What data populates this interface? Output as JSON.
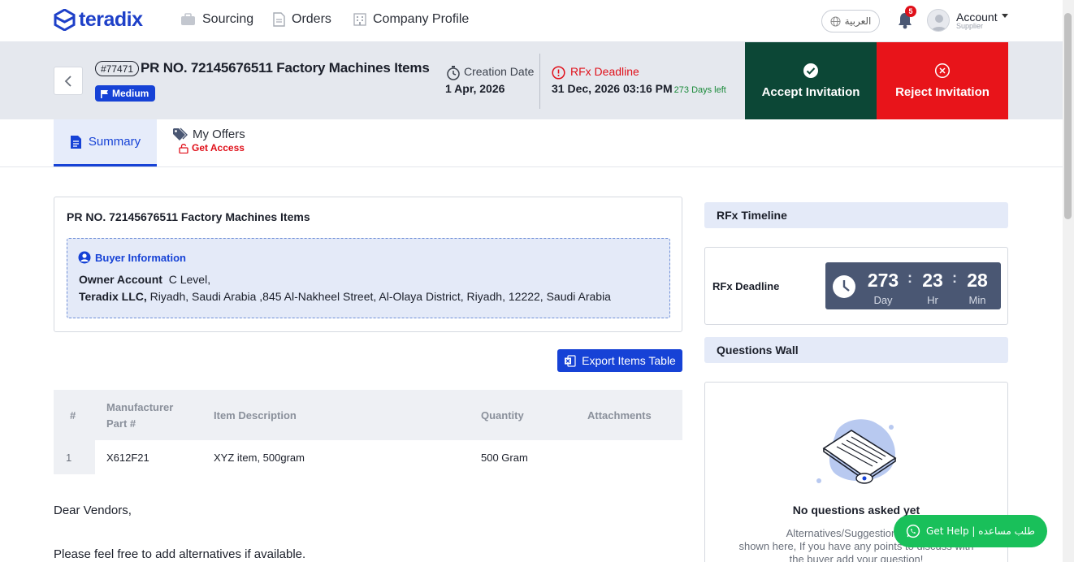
{
  "brand": {
    "name": "teradix"
  },
  "nav": {
    "sourcing": "Sourcing",
    "orders": "Orders",
    "company_profile": "Company Profile",
    "language": "العربية",
    "notifications_count": "5",
    "account_name": "Account",
    "account_role": "Supplier"
  },
  "header": {
    "pr_number_tag": "#77471",
    "title": "PR NO. 72145676511 Factory Machines Items",
    "priority": "Medium",
    "creation_date_label": "Creation Date",
    "creation_date": "1 Apr, 2026",
    "deadline_label": "RFx Deadline",
    "deadline": "31 Dec, 2026 03:16 PM",
    "days_left": "273 Days left",
    "accept_label": "Accept Invitation",
    "reject_label": "Reject Invitation"
  },
  "tabs": {
    "summary": "Summary",
    "my_offers": "My Offers",
    "get_access": "Get Access"
  },
  "summary": {
    "title": "PR NO. 72145676511 Factory Machines Items",
    "buyer_heading": "Buyer Information",
    "owner_label": "Owner Account",
    "owner_value": "C Level,",
    "company_name": "Teradix LLC,",
    "company_address": "Riyadh, Saudi Arabia ,845 Al-Nakheel Street, Al-Olaya District, Riyadh, 12222, Saudi Arabia",
    "export_label": "Export Items Table"
  },
  "items_table": {
    "headers": {
      "index": "#",
      "part_line1": "Manufacturer",
      "part_line2": "Part #",
      "description": "Item Description",
      "quantity": "Quantity",
      "attachments": "Attachments"
    },
    "rows": [
      {
        "index": "1",
        "part": "X612F21",
        "description": "XYZ item, 500gram",
        "quantity": "500 Gram",
        "attachments": ""
      }
    ]
  },
  "notes": {
    "greeting": "Dear Vendors,",
    "line1": "Please feel free to add alternatives if available."
  },
  "timeline": {
    "heading": "RFx Timeline",
    "deadline_label": "RFx Deadline",
    "days": "273",
    "days_unit": "Day",
    "hours": "23",
    "hours_unit": "Hr",
    "minutes": "28",
    "minutes_unit": "Min"
  },
  "questions": {
    "heading": "Questions Wall",
    "empty_title": "No questions asked yet",
    "empty_desc_line1": "Alternatives/Suggestions from",
    "empty_desc_line2": "shown here, If you have any points to discuss with",
    "empty_desc_line3": "the buyer add your question!"
  },
  "help": {
    "label": "Get Help | طلب مساعده"
  },
  "colors": {
    "primary": "#1642d6",
    "accept": "#0c4736",
    "reject": "#e8141a",
    "help": "#19c05a"
  }
}
